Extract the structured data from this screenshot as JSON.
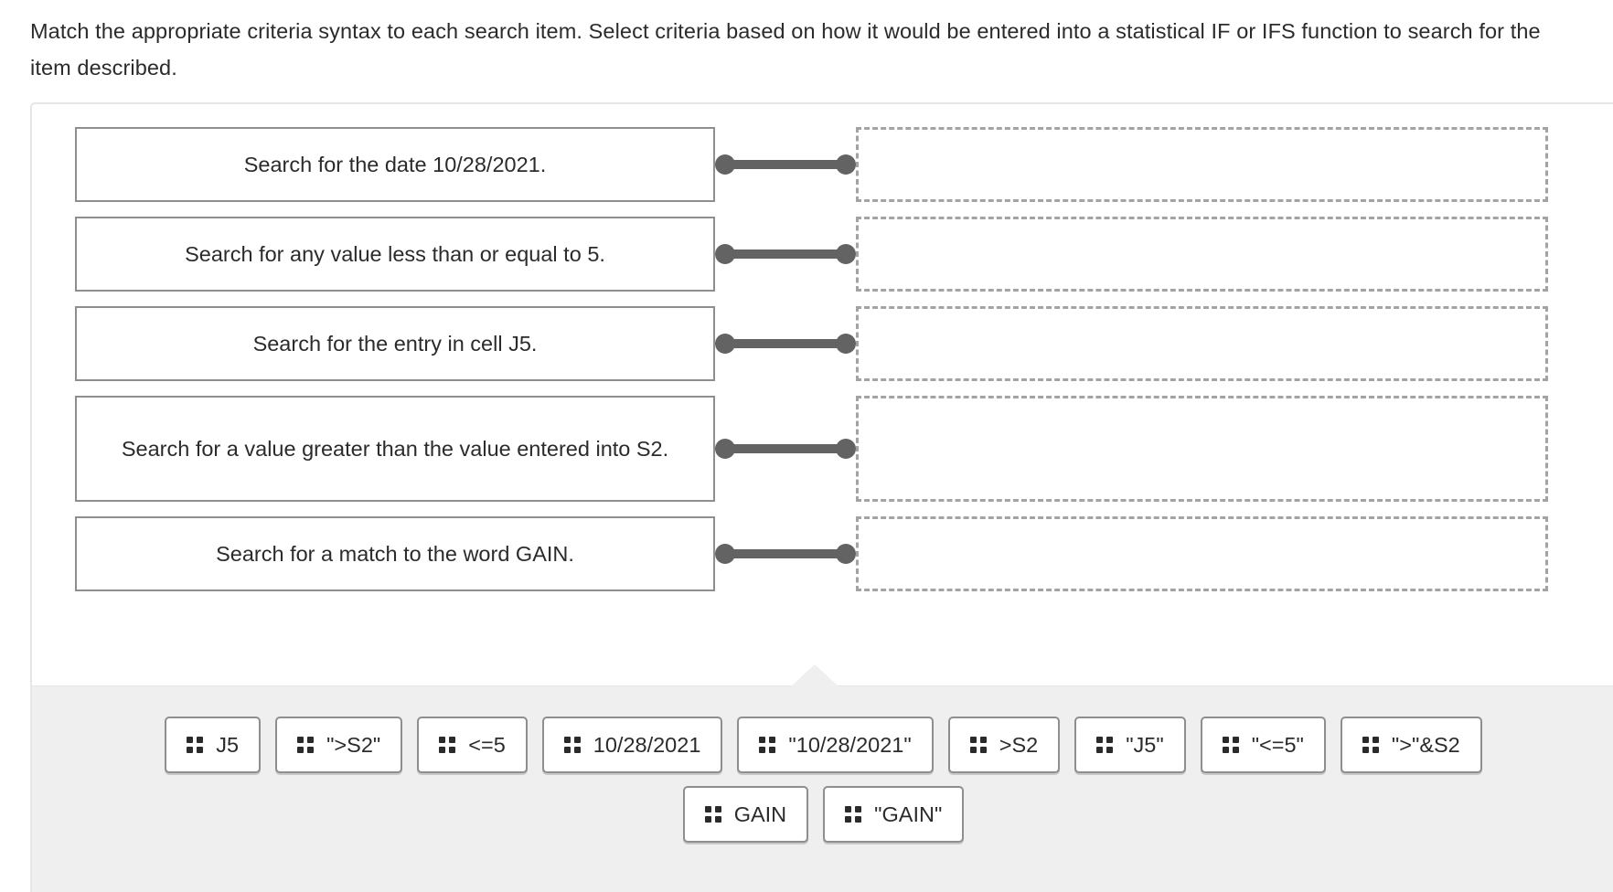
{
  "instructions": {
    "text": "Match the appropriate criteria syntax to each search item. Select criteria based on how it would be entered into a statistical IF or IFS function to search for the item described."
  },
  "colors": {
    "page_background": "#ffffff",
    "tray_background": "#efefef",
    "card_border": "#8e8e8e",
    "dropzone_border": "#a3a3a3",
    "connector": "#636363",
    "container_border": "#e6e6e6",
    "text": "#2b2b2b"
  },
  "match_rows": [
    {
      "prompt": "Search for the date 10/28/2021.",
      "answer": "",
      "lines": 1
    },
    {
      "prompt": "Search for any value less than or equal to 5.",
      "answer": "",
      "lines": 1
    },
    {
      "prompt": "Search for the entry in cell J5.",
      "answer": "",
      "lines": 1
    },
    {
      "prompt": "Search for a value greater than the value entered into S2.",
      "answer": "",
      "lines": 2
    },
    {
      "prompt": "Search for a match to the word GAIN.",
      "answer": "",
      "lines": 1
    }
  ],
  "answer_tray": {
    "rows": [
      [
        {
          "label": "J5",
          "grip": "drag-grip-icon"
        },
        {
          "label": "\">S2\"",
          "grip": "drag-grip-icon"
        },
        {
          "label": "<=5",
          "grip": "drag-grip-icon"
        },
        {
          "label": "10/28/2021",
          "grip": "drag-grip-icon"
        },
        {
          "label": "\"10/28/2021\"",
          "grip": "drag-grip-icon"
        },
        {
          "label": ">S2",
          "grip": "drag-grip-icon"
        },
        {
          "label": "\"J5\"",
          "grip": "drag-grip-icon"
        },
        {
          "label": "\"<=5\"",
          "grip": "drag-grip-icon"
        },
        {
          "label": "\">\"&S2",
          "grip": "drag-grip-icon"
        }
      ],
      [
        {
          "label": "GAIN",
          "grip": "drag-grip-icon"
        },
        {
          "label": "\"GAIN\"",
          "grip": "drag-grip-icon"
        }
      ]
    ]
  }
}
